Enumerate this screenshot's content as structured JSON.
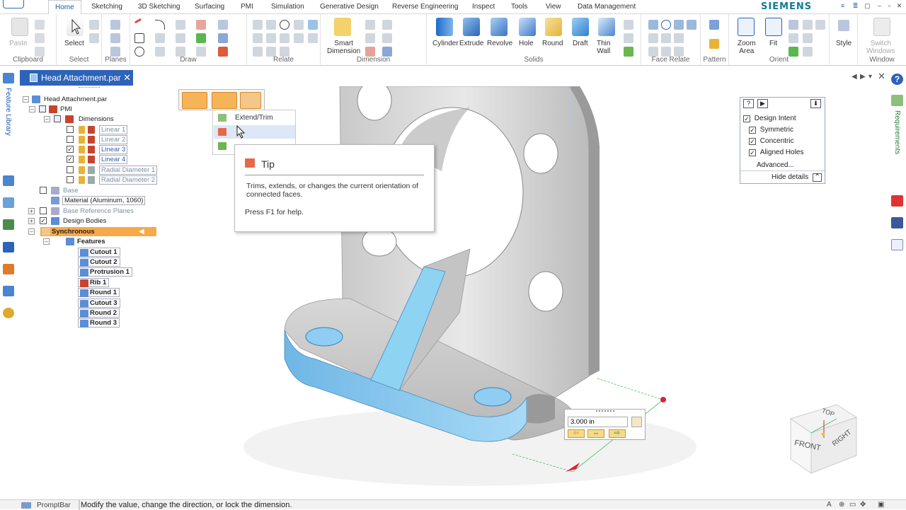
{
  "tabs": [
    "Home",
    "Sketching",
    "3D Sketching",
    "Surfacing",
    "PMI",
    "Simulation",
    "Generative Design",
    "Reverse Engineering",
    "Inspect",
    "Tools",
    "View",
    "Data Management"
  ],
  "brand": "SIEMENS",
  "ribbon": {
    "groups": [
      "Clipboard",
      "Select",
      "Planes",
      "Draw",
      "Relate",
      "Dimension",
      "Solids",
      "Face Relate",
      "Pattern",
      "Orient",
      "Window"
    ],
    "paste": "Paste",
    "select": "Select",
    "smart_dimension": "Smart\nDimension",
    "cylinder": "Cylinder",
    "extrude": "Extrude",
    "revolve": "Revolve",
    "hole": "Hole",
    "round": "Round",
    "draft": "Draft",
    "thin_wall": "Thin\nWall",
    "zoom_area": "Zoom\nArea",
    "fit": "Fit",
    "style": "Style",
    "switch_windows": "Switch\nWindows"
  },
  "document": {
    "tab_title": "Head Attachment.par"
  },
  "side_left": {
    "feature_library": "Feature Library"
  },
  "side_right": {
    "requirements": "Requirements"
  },
  "tree": {
    "root": "Head Attachment.par",
    "pmi": "PMI",
    "dimensions": "Dimensions",
    "dims": [
      {
        "label": "Linear 1",
        "checked": false
      },
      {
        "label": "Linear 2",
        "checked": false
      },
      {
        "label": "Linear 3",
        "checked": true
      },
      {
        "label": "Linear 4",
        "checked": true
      },
      {
        "label": "Radial Diameter 1",
        "checked": false
      },
      {
        "label": "Radial Diameter 2",
        "checked": false
      }
    ],
    "base": "Base",
    "material": "Material (Aluminum, 1060)",
    "base_ref_planes": "Base Reference Planes",
    "design_bodies": "Design Bodies",
    "synchronous": "Synchronous",
    "features_label": "Features",
    "features": [
      "Cutout 1",
      "Cutout 2",
      "Protrusion 1",
      "Rib 1",
      "Round 1",
      "Cutout 3",
      "Round 2",
      "Round 3"
    ]
  },
  "flyout": {
    "extend_trim": "Extend/Trim"
  },
  "tip": {
    "title": "Tip",
    "body": "Trims, extends, or changes the current orientation of connected faces.",
    "help": "Press F1 for help."
  },
  "design_intent": {
    "title": "Design Intent",
    "options": [
      {
        "label": "Symmetric",
        "checked": true
      },
      {
        "label": "Concentric",
        "checked": true
      },
      {
        "label": "Aligned Holes",
        "checked": true
      }
    ],
    "advanced": "Advanced...",
    "hide_details": "Hide details"
  },
  "dimension_edit": {
    "value": "3.000 in"
  },
  "view_cube": {
    "top": "TOP",
    "front": "FRONT",
    "right": "RIGHT"
  },
  "status": {
    "prompt_bar": "PromptBar",
    "message": "Modify the value, change the direction, or lock the dimension."
  },
  "colors": {
    "accent": "#2d63b8",
    "highlight": "#f7a94a",
    "selected_face": "#7ec4ec",
    "brand": "#0f7b99"
  }
}
